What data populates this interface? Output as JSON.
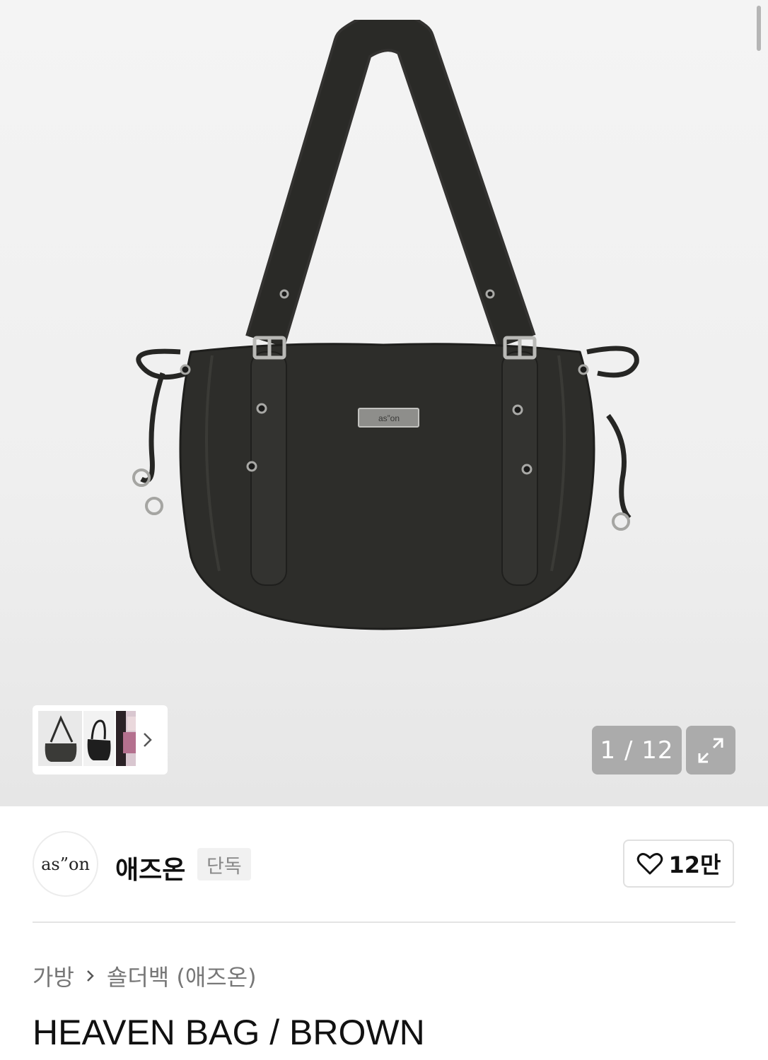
{
  "gallery": {
    "counter": "1 / 12",
    "colors": {
      "counter_bg": "#ababab",
      "bag": "#2b2b28"
    }
  },
  "brand": {
    "logo_text": "as”on",
    "name": "애즈온",
    "exclusive_badge": "단독",
    "like_count": "12만"
  },
  "breadcrumb": {
    "items": [
      "가방",
      "숄더백 (애즈온)"
    ]
  },
  "product": {
    "title": "HEAVEN BAG / BROWN",
    "plate_text": "as”on"
  }
}
